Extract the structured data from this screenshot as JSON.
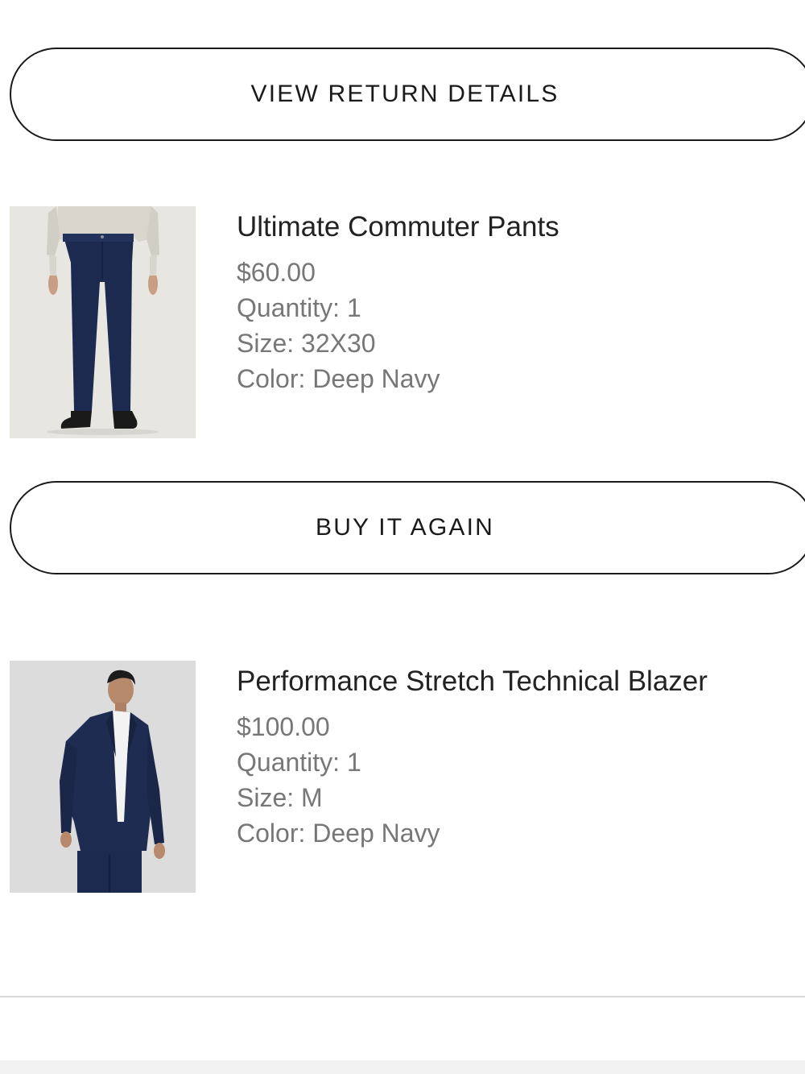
{
  "buttons": {
    "view_return_details": "VIEW RETURN DETAILS",
    "buy_it_again": "BUY IT AGAIN"
  },
  "products": [
    {
      "name": "Ultimate Commuter Pants",
      "price": "$60.00",
      "quantity": "Quantity: 1",
      "size": "Size: 32X30",
      "color": "Color: Deep Navy",
      "image": "pants-product-photo"
    },
    {
      "name": "Performance Stretch Technical Blazer",
      "price": "$100.00",
      "quantity": "Quantity: 1",
      "size": "Size: M",
      "color": "Color: Deep Navy",
      "image": "blazer-product-photo"
    }
  ],
  "colors": {
    "button_border": "#1a1a1a",
    "name_text": "#222222",
    "meta_text": "#777777",
    "navy": "#1c2a4f"
  }
}
